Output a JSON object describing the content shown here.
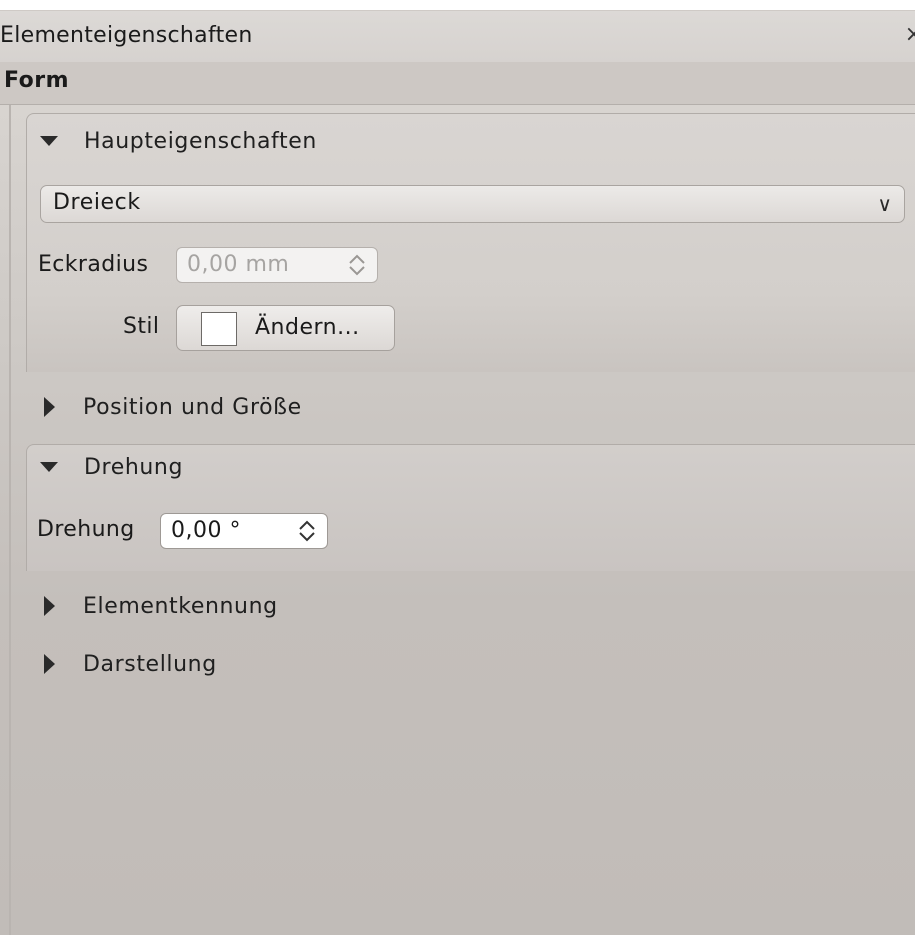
{
  "dock": {
    "title": "Elementeigenschaften",
    "close_glyph": "×"
  },
  "header": {
    "label": "Form"
  },
  "sections": {
    "main_props": {
      "label": "Haupteigenschaften",
      "expanded": true
    },
    "position_size": {
      "label": "Position und Größe",
      "expanded": false
    },
    "rotation": {
      "label": "Drehung",
      "expanded": true
    },
    "element_id": {
      "label": "Elementkennung",
      "expanded": false
    },
    "appearance": {
      "label": "Darstellung",
      "expanded": false
    }
  },
  "shape_combo": {
    "value": "Dreieck",
    "icon": "chevron-down-icon"
  },
  "corner_radius": {
    "label": "Eckradius",
    "value": "0,00 mm",
    "enabled": false
  },
  "style": {
    "label": "Stil",
    "button_label": "Ändern...",
    "swatch_color": "#ffffff"
  },
  "rotation_field": {
    "label": "Drehung",
    "value": "0,00 °"
  },
  "colors": {
    "panel_bg": "#c4bfbb",
    "titlebar_bg": "#d8d4d1",
    "text": "#1a1a1a"
  }
}
